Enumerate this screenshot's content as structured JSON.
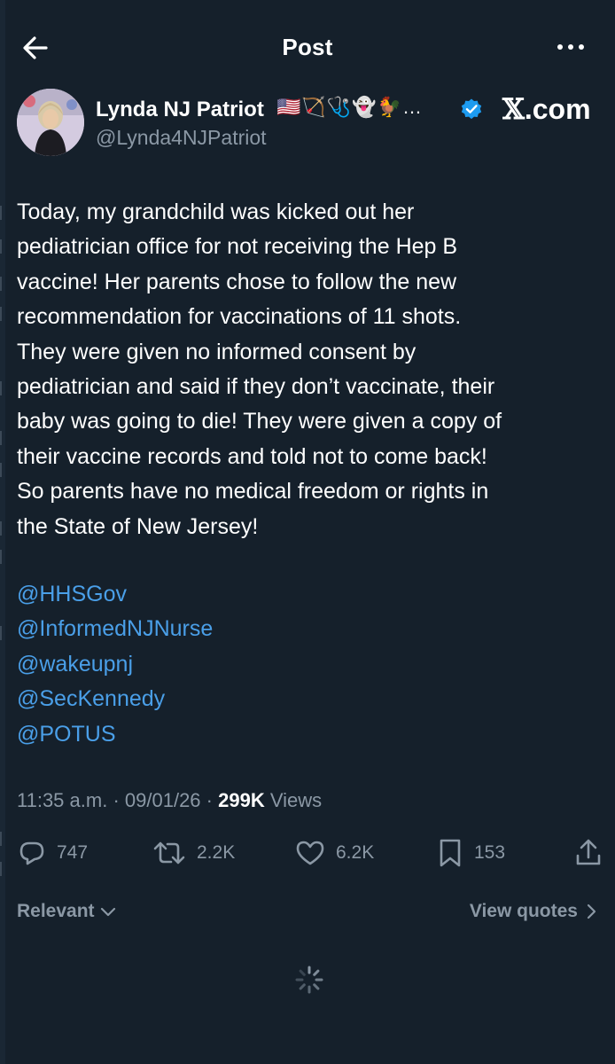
{
  "header": {
    "title": "Post"
  },
  "author": {
    "name": "Lynda NJ Patriot",
    "emojis": "🇺🇸🏹🩺👻🐓…",
    "handle": "@Lynda4NJPatriot"
  },
  "watermark": {
    "x": "𝕏",
    "domain": ".com"
  },
  "post": {
    "lines": [
      "Today, my grandchild was kicked out her",
      "pediatrician office for not receiving the Hep B",
      "vaccine!  Her parents chose to follow the new",
      "recommendation for vaccinations of 11 shots.",
      "They were given no informed consent by",
      "pediatrician and said if they don’t vaccinate, their",
      "baby was going to die!  They were given a copy of",
      "their vaccine records and told not to come back!",
      "So parents have no medical freedom or rights in",
      "the State of New Jersey!"
    ],
    "mentions": [
      "@HHSGov",
      "@InformedNJNurse",
      "@wakeupnj",
      "@SecKennedy",
      "@POTUS"
    ]
  },
  "meta": {
    "time": "11:35 a.m.",
    "date": "09/01/26",
    "views_count": "299K",
    "views_label": "Views"
  },
  "actions": {
    "replies": "747",
    "reposts": "2.2K",
    "likes": "6.2K",
    "bookmarks": "153"
  },
  "footer": {
    "sort_label": "Relevant",
    "view_quotes_label": "View quotes"
  },
  "colors": {
    "background": "#15202b",
    "accent": "#1d9bf0",
    "mention": "#4a9fe8",
    "muted": "#8b98a5"
  }
}
